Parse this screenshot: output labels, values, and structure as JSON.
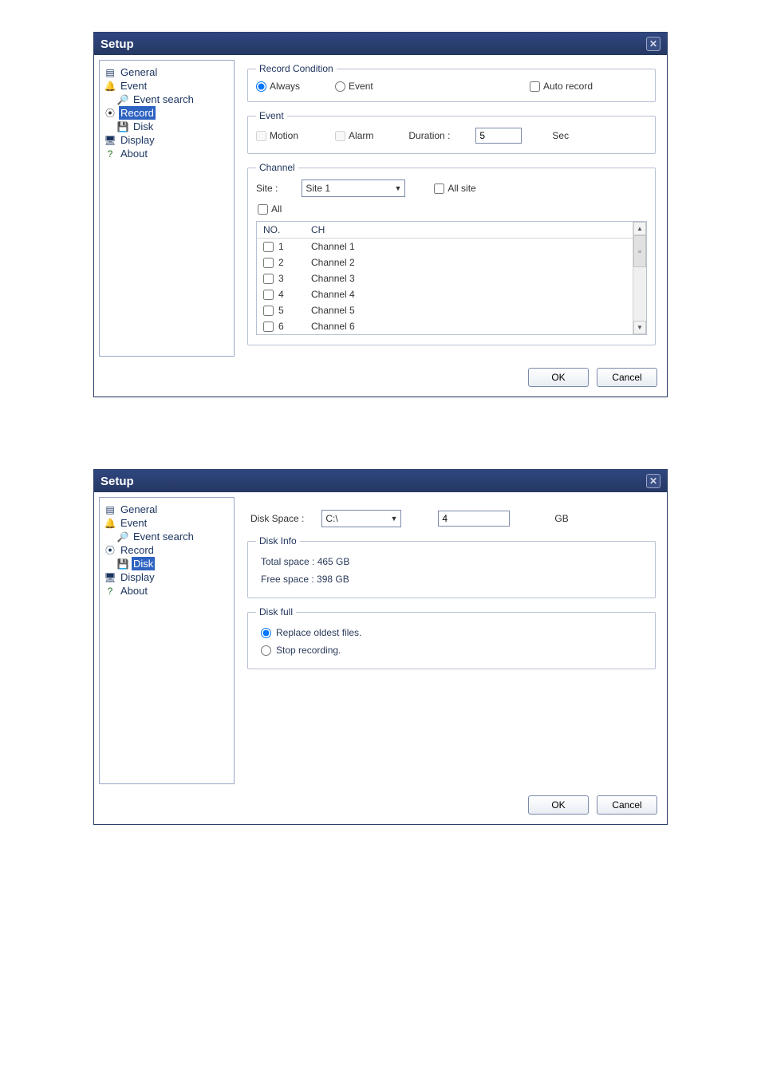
{
  "dialog1": {
    "title": "Setup",
    "tree": {
      "general": "General",
      "event": "Event",
      "event_search": "Event search",
      "record": "Record",
      "disk": "Disk",
      "display": "Display",
      "about": "About"
    },
    "record_condition": {
      "legend": "Record Condition",
      "always": "Always",
      "event": "Event",
      "auto_record": "Auto record"
    },
    "event": {
      "legend": "Event",
      "motion": "Motion",
      "alarm": "Alarm",
      "duration_label": "Duration :",
      "duration_value": "5",
      "sec": "Sec"
    },
    "channel": {
      "legend": "Channel",
      "site_label": "Site :",
      "site_value": "Site 1",
      "all_site": "All site",
      "all_label": "All",
      "header_no": "NO.",
      "header_ch": "CH",
      "rows": [
        {
          "no": "1",
          "ch": "Channel 1"
        },
        {
          "no": "2",
          "ch": "Channel 2"
        },
        {
          "no": "3",
          "ch": "Channel 3"
        },
        {
          "no": "4",
          "ch": "Channel 4"
        },
        {
          "no": "5",
          "ch": "Channel 5"
        },
        {
          "no": "6",
          "ch": "Channel 6"
        }
      ]
    },
    "buttons": {
      "ok": "OK",
      "cancel": "Cancel"
    }
  },
  "dialog2": {
    "title": "Setup",
    "tree": {
      "general": "General",
      "event": "Event",
      "event_search": "Event search",
      "record": "Record",
      "disk": "Disk",
      "display": "Display",
      "about": "About"
    },
    "disk_space": {
      "label": "Disk Space :",
      "drive": "C:\\",
      "value": "4",
      "unit": "GB"
    },
    "disk_info": {
      "legend": "Disk Info",
      "total": "Total space : 465 GB",
      "free": "Free space : 398 GB"
    },
    "disk_full": {
      "legend": "Disk full",
      "replace": "Replace oldest files.",
      "stop": "Stop recording."
    },
    "buttons": {
      "ok": "OK",
      "cancel": "Cancel"
    }
  }
}
